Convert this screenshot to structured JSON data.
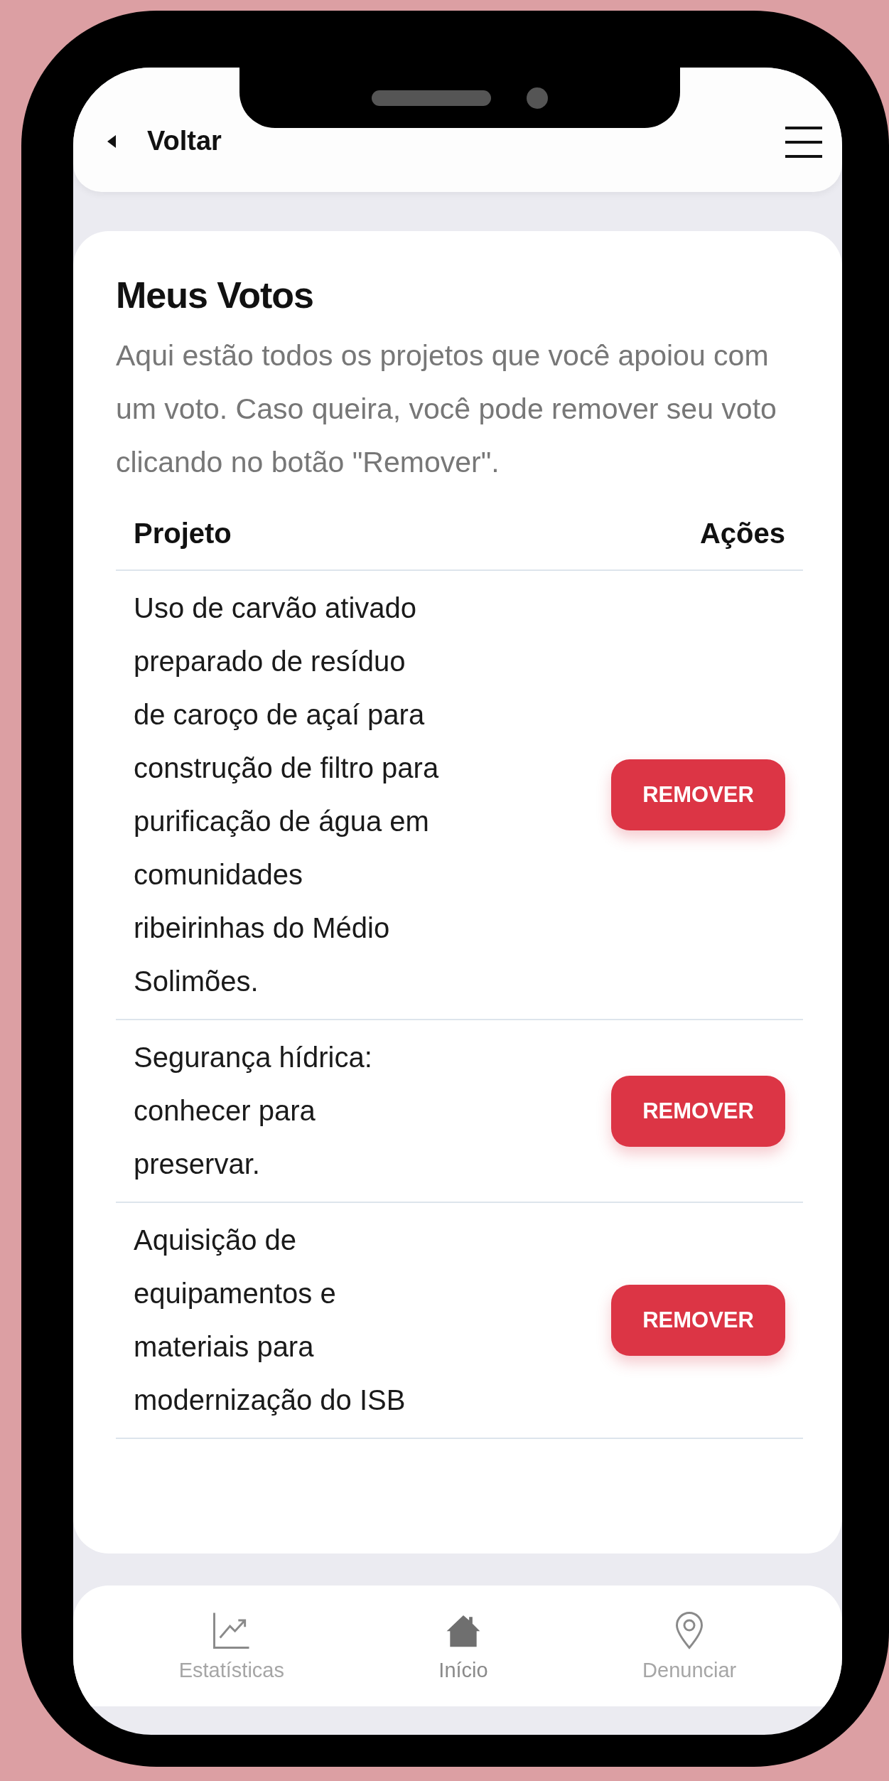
{
  "header": {
    "back_label": "Voltar"
  },
  "page": {
    "title": "Meus Votos",
    "description": "Aqui estão todos os projetos que você apoiou com um voto. Caso queira, você pode remover seu voto clicando no botão \"Remover\"."
  },
  "table": {
    "columns": [
      "Projeto",
      "Ações"
    ],
    "rows": [
      {
        "project": "Uso de carvão ativado preparado de resíduo de caroço de açaí para construção de filtro para purificação de água em comunidades ribeirinhas do Médio Solimões.",
        "action": "REMOVER"
      },
      {
        "project": "Segurança hídrica: conhecer para preservar.",
        "action": "REMOVER"
      },
      {
        "project": "Aquisição de equipamentos e materiais para modernização do ISB",
        "action": "REMOVER"
      }
    ]
  },
  "bottom_nav": [
    {
      "kind": "chart",
      "label": "Estatísticas",
      "selected": false
    },
    {
      "kind": "home",
      "label": "Início",
      "selected": true
    },
    {
      "kind": "pin",
      "label": "Denunciar",
      "selected": false
    }
  ]
}
